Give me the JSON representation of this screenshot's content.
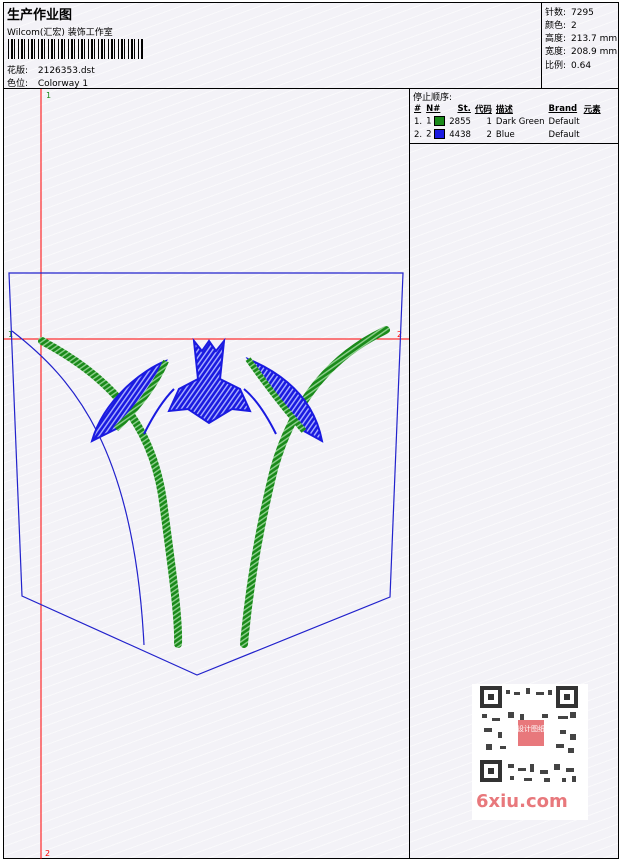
{
  "header": {
    "title": "生产作业图",
    "studio": "Wilcom(汇宏) 装饰工作室",
    "design_label": "花版:",
    "design_value": "2126353.dst",
    "color_label": "色位:",
    "color_value": "Colorway 1"
  },
  "stats": {
    "stitches_label": "针数:",
    "stitches_value": "7295",
    "colors_label": "颜色:",
    "colors_value": "2",
    "height_label": "高度:",
    "height_value": "213.7 mm",
    "width_label": "宽度:",
    "width_value": "208.9 mm",
    "ratio_label": "比例:",
    "ratio_value": "0.64"
  },
  "stop_sequence": {
    "title": "停止顺序:",
    "columns": [
      "#",
      "N#",
      "St.",
      "代码",
      "描述",
      "Brand",
      "元素"
    ],
    "rows": [
      {
        "index": "1.",
        "needle": "1",
        "color": "#1a8a1a",
        "stitches": "2855",
        "code": "1",
        "description": "Dark Green",
        "brand": "Default"
      },
      {
        "index": "2.",
        "needle": "2",
        "color": "#1a1ae0",
        "stitches": "4438",
        "code": "2",
        "description": "Blue",
        "brand": "Default"
      }
    ]
  },
  "canvas": {
    "guide_v_top": "1",
    "guide_v_bottom": "2",
    "guide_h_left": "1",
    "guide_h_right": "2",
    "guide_color": "#ff0000",
    "outline_color": "#2222cc",
    "thread_green": "#1a8a1a",
    "thread_blue": "#1a1ae0"
  },
  "watermark": {
    "qr_stamp": "设计图纸",
    "text": "6xiu.com"
  }
}
